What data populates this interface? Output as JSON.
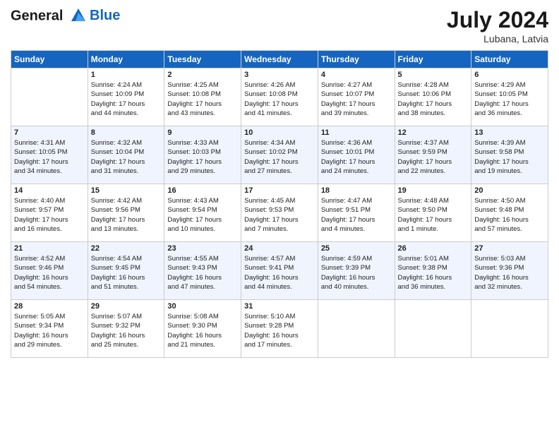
{
  "header": {
    "logo_line1": "General",
    "logo_line2": "Blue",
    "month_year": "July 2024",
    "location": "Lubana, Latvia"
  },
  "columns": [
    "Sunday",
    "Monday",
    "Tuesday",
    "Wednesday",
    "Thursday",
    "Friday",
    "Saturday"
  ],
  "weeks": [
    [
      {
        "day": "",
        "content": ""
      },
      {
        "day": "1",
        "content": "Sunrise: 4:24 AM\nSunset: 10:09 PM\nDaylight: 17 hours\nand 44 minutes."
      },
      {
        "day": "2",
        "content": "Sunrise: 4:25 AM\nSunset: 10:08 PM\nDaylight: 17 hours\nand 43 minutes."
      },
      {
        "day": "3",
        "content": "Sunrise: 4:26 AM\nSunset: 10:08 PM\nDaylight: 17 hours\nand 41 minutes."
      },
      {
        "day": "4",
        "content": "Sunrise: 4:27 AM\nSunset: 10:07 PM\nDaylight: 17 hours\nand 39 minutes."
      },
      {
        "day": "5",
        "content": "Sunrise: 4:28 AM\nSunset: 10:06 PM\nDaylight: 17 hours\nand 38 minutes."
      },
      {
        "day": "6",
        "content": "Sunrise: 4:29 AM\nSunset: 10:05 PM\nDaylight: 17 hours\nand 36 minutes."
      }
    ],
    [
      {
        "day": "7",
        "content": "Sunrise: 4:31 AM\nSunset: 10:05 PM\nDaylight: 17 hours\nand 34 minutes."
      },
      {
        "day": "8",
        "content": "Sunrise: 4:32 AM\nSunset: 10:04 PM\nDaylight: 17 hours\nand 31 minutes."
      },
      {
        "day": "9",
        "content": "Sunrise: 4:33 AM\nSunset: 10:03 PM\nDaylight: 17 hours\nand 29 minutes."
      },
      {
        "day": "10",
        "content": "Sunrise: 4:34 AM\nSunset: 10:02 PM\nDaylight: 17 hours\nand 27 minutes."
      },
      {
        "day": "11",
        "content": "Sunrise: 4:36 AM\nSunset: 10:01 PM\nDaylight: 17 hours\nand 24 minutes."
      },
      {
        "day": "12",
        "content": "Sunrise: 4:37 AM\nSunset: 9:59 PM\nDaylight: 17 hours\nand 22 minutes."
      },
      {
        "day": "13",
        "content": "Sunrise: 4:39 AM\nSunset: 9:58 PM\nDaylight: 17 hours\nand 19 minutes."
      }
    ],
    [
      {
        "day": "14",
        "content": "Sunrise: 4:40 AM\nSunset: 9:57 PM\nDaylight: 17 hours\nand 16 minutes."
      },
      {
        "day": "15",
        "content": "Sunrise: 4:42 AM\nSunset: 9:56 PM\nDaylight: 17 hours\nand 13 minutes."
      },
      {
        "day": "16",
        "content": "Sunrise: 4:43 AM\nSunset: 9:54 PM\nDaylight: 17 hours\nand 10 minutes."
      },
      {
        "day": "17",
        "content": "Sunrise: 4:45 AM\nSunset: 9:53 PM\nDaylight: 17 hours\nand 7 minutes."
      },
      {
        "day": "18",
        "content": "Sunrise: 4:47 AM\nSunset: 9:51 PM\nDaylight: 17 hours\nand 4 minutes."
      },
      {
        "day": "19",
        "content": "Sunrise: 4:48 AM\nSunset: 9:50 PM\nDaylight: 17 hours\nand 1 minute."
      },
      {
        "day": "20",
        "content": "Sunrise: 4:50 AM\nSunset: 9:48 PM\nDaylight: 16 hours\nand 57 minutes."
      }
    ],
    [
      {
        "day": "21",
        "content": "Sunrise: 4:52 AM\nSunset: 9:46 PM\nDaylight: 16 hours\nand 54 minutes."
      },
      {
        "day": "22",
        "content": "Sunrise: 4:54 AM\nSunset: 9:45 PM\nDaylight: 16 hours\nand 51 minutes."
      },
      {
        "day": "23",
        "content": "Sunrise: 4:55 AM\nSunset: 9:43 PM\nDaylight: 16 hours\nand 47 minutes."
      },
      {
        "day": "24",
        "content": "Sunrise: 4:57 AM\nSunset: 9:41 PM\nDaylight: 16 hours\nand 44 minutes."
      },
      {
        "day": "25",
        "content": "Sunrise: 4:59 AM\nSunset: 9:39 PM\nDaylight: 16 hours\nand 40 minutes."
      },
      {
        "day": "26",
        "content": "Sunrise: 5:01 AM\nSunset: 9:38 PM\nDaylight: 16 hours\nand 36 minutes."
      },
      {
        "day": "27",
        "content": "Sunrise: 5:03 AM\nSunset: 9:36 PM\nDaylight: 16 hours\nand 32 minutes."
      }
    ],
    [
      {
        "day": "28",
        "content": "Sunrise: 5:05 AM\nSunset: 9:34 PM\nDaylight: 16 hours\nand 29 minutes."
      },
      {
        "day": "29",
        "content": "Sunrise: 5:07 AM\nSunset: 9:32 PM\nDaylight: 16 hours\nand 25 minutes."
      },
      {
        "day": "30",
        "content": "Sunrise: 5:08 AM\nSunset: 9:30 PM\nDaylight: 16 hours\nand 21 minutes."
      },
      {
        "day": "31",
        "content": "Sunrise: 5:10 AM\nSunset: 9:28 PM\nDaylight: 16 hours\nand 17 minutes."
      },
      {
        "day": "",
        "content": ""
      },
      {
        "day": "",
        "content": ""
      },
      {
        "day": "",
        "content": ""
      }
    ]
  ]
}
